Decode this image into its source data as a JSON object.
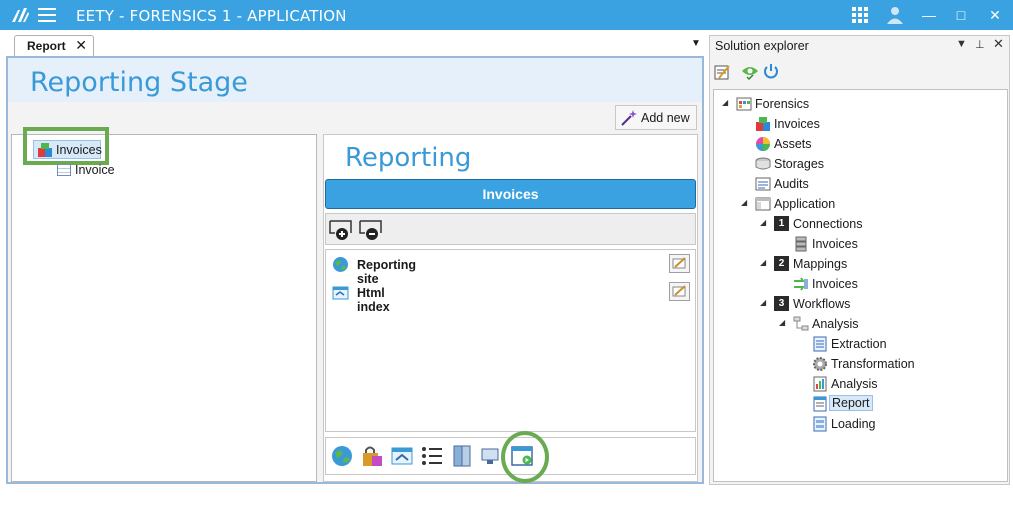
{
  "window": {
    "title": "EETY - FORENSICS 1 - APPLICATION"
  },
  "document_tab": {
    "label": "Report"
  },
  "stage": {
    "title": "Reporting Stage",
    "add_new_label": "Add new"
  },
  "left_tree": {
    "root_label": "Invoices",
    "child_label": "Invoice"
  },
  "content": {
    "title": "Reporting",
    "banner": "Invoices",
    "rows": [
      {
        "label": "Reporting site",
        "icon": "globe-icon"
      },
      {
        "label": "Html index",
        "icon": "html-icon"
      }
    ]
  },
  "solution_explorer": {
    "title": "Solution explorer",
    "nodes": [
      {
        "label": "Forensics",
        "icon": "solution-icon"
      },
      {
        "label": "Invoices",
        "icon": "cube-icon"
      },
      {
        "label": "Assets",
        "icon": "palette-icon"
      },
      {
        "label": "Storages",
        "icon": "storage-icon"
      },
      {
        "label": "Audits",
        "icon": "audit-icon"
      },
      {
        "label": "Application",
        "icon": "application-icon"
      },
      {
        "label": "Connections",
        "num": "1"
      },
      {
        "label": "Invoices",
        "icon": "server-icon"
      },
      {
        "label": "Mappings",
        "num": "2"
      },
      {
        "label": "Invoices",
        "icon": "mapping-icon"
      },
      {
        "label": "Workflows",
        "num": "3"
      },
      {
        "label": "Analysis",
        "icon": "workflow-icon"
      },
      {
        "label": "Extraction",
        "icon": "extraction-icon"
      },
      {
        "label": "Transformation",
        "icon": "gear-icon"
      },
      {
        "label": "Analysis",
        "icon": "analysis-icon"
      },
      {
        "label": "Report",
        "icon": "report-icon"
      },
      {
        "label": "Loading",
        "icon": "loading-icon"
      }
    ]
  },
  "colors": {
    "accent": "#3aa2e0",
    "highlight": "#6aab52",
    "stage_title": "#3a9ad8"
  }
}
